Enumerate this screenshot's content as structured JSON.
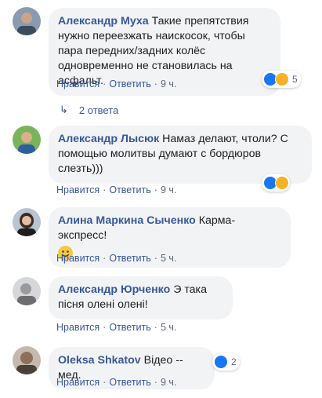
{
  "actions": {
    "like": "Нравится",
    "reply": "Ответить",
    "separator": "·"
  },
  "comments": [
    {
      "author": "Александр Муха",
      "text": "Такие препятствия нужно переезжать наискосок, чтобы пара передних/задних колёс одновременно не становилась на асфальт.",
      "time": "9 ч.",
      "reactions": {
        "icons": [
          "like-icon",
          "haha-icon"
        ],
        "count": "5"
      },
      "replies": "2 ответа"
    },
    {
      "author": "Александр Лысюк",
      "text": "Намаз делают, чтоли? С помощью молитвы думают с бордюров слезть)))",
      "time": "9 ч.",
      "reactions": {
        "icons": [
          "like-icon",
          "haha-icon"
        ],
        "count": ""
      }
    },
    {
      "author": "Алина Маркина Сыченко",
      "text": "Карма-экспресс!",
      "emoji": "smile-emoji",
      "time": "5 ч."
    },
    {
      "author": "Александр Юрченко",
      "text": "Э така пісня олені олені!",
      "time": "5 ч."
    },
    {
      "author": "Oleksa Shkatov",
      "text": "Відео -- мед.",
      "time": "9 ч.",
      "reactions": {
        "icons": [
          "like-icon"
        ],
        "count": "2"
      }
    }
  ],
  "colors": {
    "author": "#385898",
    "bubble": "#f2f3f5",
    "meta": "#606770",
    "like": "#1877f2",
    "haha": "#f7b125"
  }
}
